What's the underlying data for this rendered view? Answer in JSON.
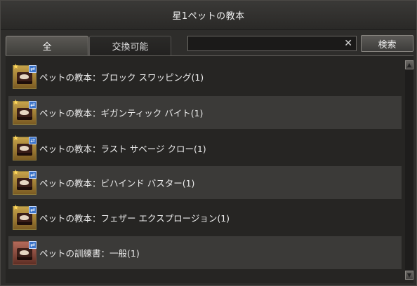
{
  "window": {
    "title": "星1ペットの教本"
  },
  "tabs": [
    {
      "label": "全"
    },
    {
      "label": "交換可能"
    }
  ],
  "search": {
    "value": "",
    "placeholder": "",
    "clear_icon": "close-icon",
    "button_label": "検索"
  },
  "items": [
    {
      "label": "ペットの教本：ブロック スワッピング(1)",
      "icon": "pet-book-icon"
    },
    {
      "label": "ペットの教本：ギガンティック バイト(1)",
      "icon": "pet-book-icon"
    },
    {
      "label": "ペットの教本：ラスト サベージ クロー(1)",
      "icon": "pet-book-icon"
    },
    {
      "label": "ペットの教本：ビハインド バスター(1)",
      "icon": "pet-book-icon"
    },
    {
      "label": "ペットの教本：フェザー エクスプロージョン(1)",
      "icon": "pet-book-icon"
    },
    {
      "label": "ペットの訓練書：一般(1)",
      "icon": "training-book-icon"
    }
  ],
  "scrollbar": {
    "up_icon": "arrow-up-icon",
    "down_icon": "arrow-down-icon"
  }
}
